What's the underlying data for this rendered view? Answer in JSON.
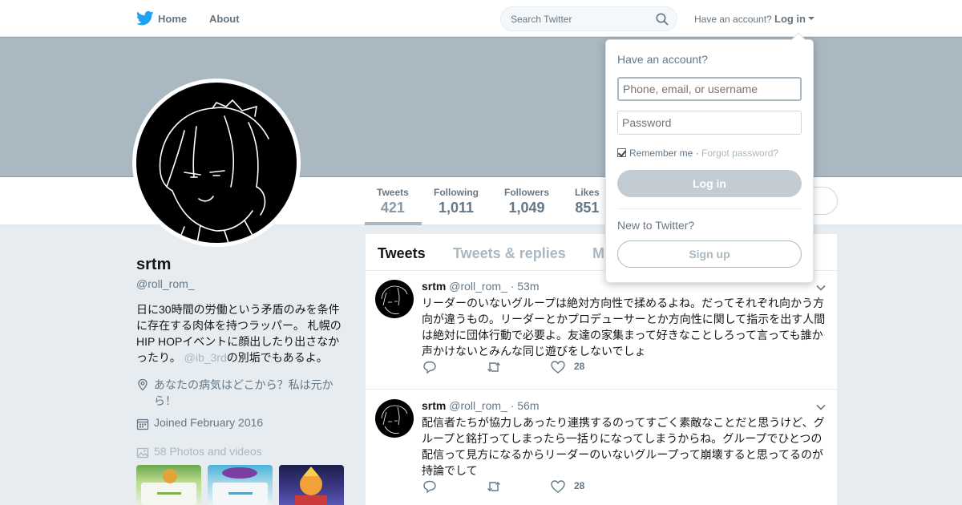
{
  "nav": {
    "home_label": "Home",
    "about_label": "About",
    "search_placeholder": "Search Twitter",
    "have_account": "Have an account?",
    "login_label": "Log in"
  },
  "profile": {
    "name": "srtm",
    "handle": "@roll_rom_",
    "bio": "日に30時間の労働という矛盾のみを条件に存在する肉体を持つラッパー。 札幌のHIP HOPイベントに顔出したり出さなかったり。 ",
    "bio_mention": "@ib_3rd",
    "bio_suffix": "の別垢でもあるよ。",
    "location": "あなたの病気はどこから？私は元から！",
    "joined": "Joined February 2016",
    "photos": "58 Photos and videos"
  },
  "stats": [
    {
      "label": "Tweets",
      "value": "421"
    },
    {
      "label": "Following",
      "value": "1,011"
    },
    {
      "label": "Followers",
      "value": "1,049"
    },
    {
      "label": "Likes",
      "value": "851"
    }
  ],
  "tabs": [
    "Tweets",
    "Tweets & replies",
    "M"
  ],
  "tweets": [
    {
      "name": "srtm",
      "handle": "@roll_rom_",
      "time": "· 53m",
      "text": "リーダーのいないグループは絶対方向性で揉めるよね。だってそれぞれ向かう方向が違うもの。リーダーとかプロデューサーとか方向性に関して指示を出す人間は絶対に団体行動で必要よ。友達の家集まって好きなことしろって言っても誰か声かけないとみんな同じ遊びをしないでしょ",
      "likes": "28"
    },
    {
      "name": "srtm",
      "handle": "@roll_rom_",
      "time": "· 56m",
      "text": "配信者たちが協力しあったり連携するのってすごく素敵なことだと思うけど、グループと銘打ってしまったら一括りになってしまうからね。グループでひとつの配信って見方になるからリーダーのいないグループって崩壊すると思ってるのが持論でして",
      "likes": "28"
    }
  ],
  "login": {
    "title": "Have an account?",
    "username_placeholder": "Phone, email, or username",
    "password_placeholder": "Password",
    "remember": "Remember me",
    "separator": " · ",
    "forgot": "Forgot password?",
    "login_button": "Log in",
    "new_to": "New to Twitter?",
    "signup_button": "Sign up"
  },
  "colors": {
    "twitter_blue": "#1da1f2",
    "banner": "#aab8c2",
    "muted": "#657786"
  },
  "icons": [
    "twitter-bird-icon",
    "search-icon",
    "caret-down-icon",
    "location-icon",
    "calendar-icon",
    "photo-icon",
    "reply-icon",
    "retweet-icon",
    "heart-icon",
    "chevron-down-icon"
  ]
}
